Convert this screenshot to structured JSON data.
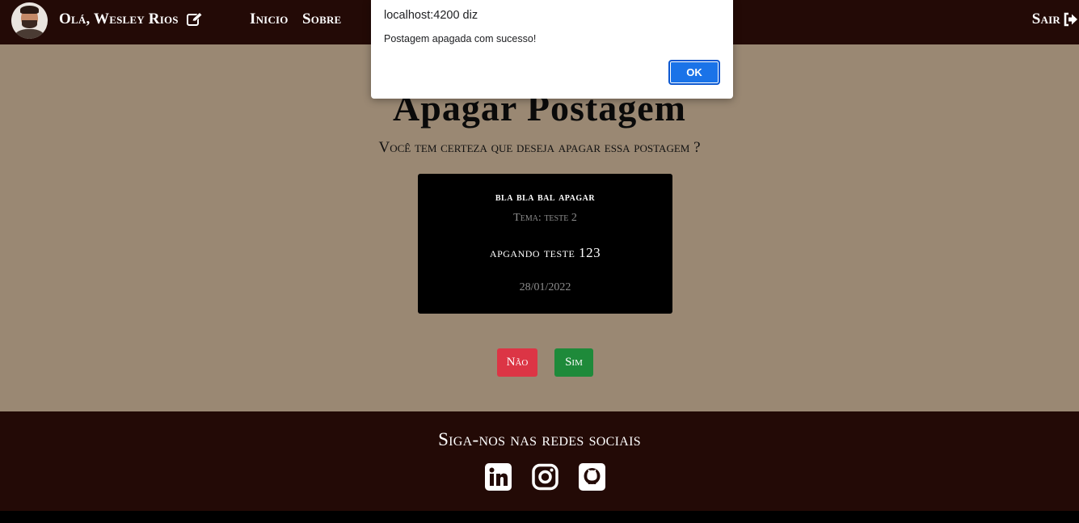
{
  "navbar": {
    "greeting": "Olá, Wesley Rios",
    "nav_links": [
      "Inicio",
      "Sobre"
    ],
    "logout_label": "Sair",
    "background": "#230a06"
  },
  "main": {
    "title": "Apagar Postagem",
    "confirm_question": "Você tem certeza que deseja apagar essa postagem ?",
    "post": {
      "title": "bla bla bal apagar",
      "theme": "Tema: teste 2",
      "text": "apgando teste 123",
      "date": "28/01/2022"
    },
    "no_label": "Não",
    "yes_label": "Sim"
  },
  "footer": {
    "title": "Siga-nos nas redes sociais",
    "socials": [
      "linkedin-icon",
      "instagram-icon",
      "github-icon"
    ]
  },
  "dialog": {
    "origin": "localhost:4200 diz",
    "message": "Postagem apagada com sucesso!",
    "ok_label": "OK"
  },
  "colors": {
    "page_bg": "#9a8873",
    "danger": "#dc3545",
    "success": "#1e8a3a",
    "dialog_button": "#1a73e8"
  }
}
